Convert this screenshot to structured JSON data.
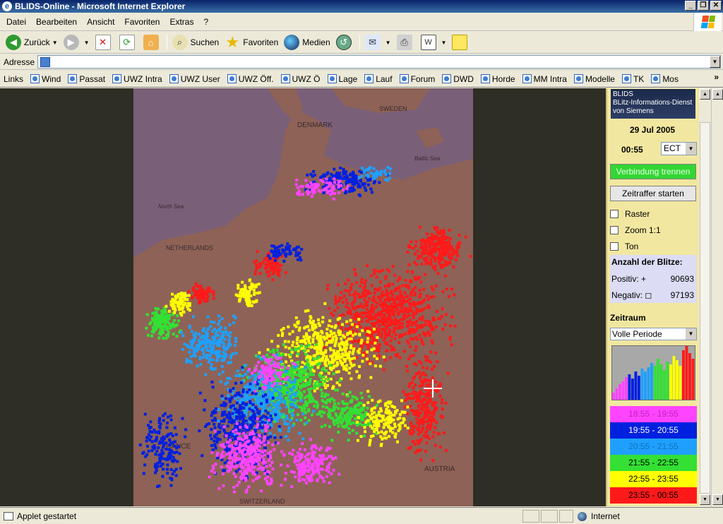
{
  "window": {
    "title": "BLIDS-Online - Microsoft Internet Explorer"
  },
  "menu": {
    "items": [
      "Datei",
      "Bearbeiten",
      "Ansicht",
      "Favoriten",
      "Extras",
      "?"
    ]
  },
  "toolbar": {
    "back": "Zurück",
    "search": "Suchen",
    "favorites": "Favoriten",
    "media": "Medien"
  },
  "address": {
    "label": "Adresse",
    "value": ""
  },
  "links": {
    "label": "Links",
    "items": [
      "Wind",
      "Passat",
      "UWZ Intra",
      "UWZ User",
      "UWZ Öff.",
      "UWZ Ö",
      "Lage",
      "Lauf",
      "Forum",
      "DWD",
      "Horde",
      "MM Intra",
      "Modelle",
      "TK",
      "Mos"
    ]
  },
  "map": {
    "labels": [
      "DENMARK",
      "Baltic Sea",
      "North Sea",
      "NETHERLANDS",
      "AUSTRIA",
      "FRANCE",
      "SWITZERLAND",
      "SWEDEN"
    ]
  },
  "panel": {
    "logo": [
      "BLIDS",
      "BLitz-Informations-Dienst",
      "von Siemens"
    ],
    "date": "29 Jul 2005",
    "time": "00:55",
    "timezone": "ECT",
    "disconnect_button": "Verbindung trennen",
    "timelapse_button": "Zeitraffer starten",
    "options": [
      "Raster",
      "Zoom 1:1",
      "Ton"
    ],
    "count_title": "Anzahl der Blitze:",
    "positive_label": "Positiv: +",
    "positive_value": "90693",
    "negative_label": "Negativ: ◻",
    "negative_value": "97193",
    "period_title": "Zeitraum",
    "period_value": "Volle Periode",
    "legend": [
      {
        "label": "18:55 - 19:55",
        "color": "#ff44ff",
        "text": "#c020c0"
      },
      {
        "label": "19:55 - 20:55",
        "color": "#0020e0",
        "text": "#ffffff"
      },
      {
        "label": "20:55 - 21:55",
        "color": "#1fa0ff",
        "text": "#1070c0"
      },
      {
        "label": "21:55 - 22:55",
        "color": "#33e033",
        "text": "#000000"
      },
      {
        "label": "22:55 - 23:55",
        "color": "#ffff00",
        "text": "#000000"
      },
      {
        "label": "23:55 - 00:55",
        "color": "#ff1a1a",
        "text": "#000000"
      }
    ]
  },
  "status": {
    "text": "Applet gestartet",
    "zone": "Internet"
  }
}
